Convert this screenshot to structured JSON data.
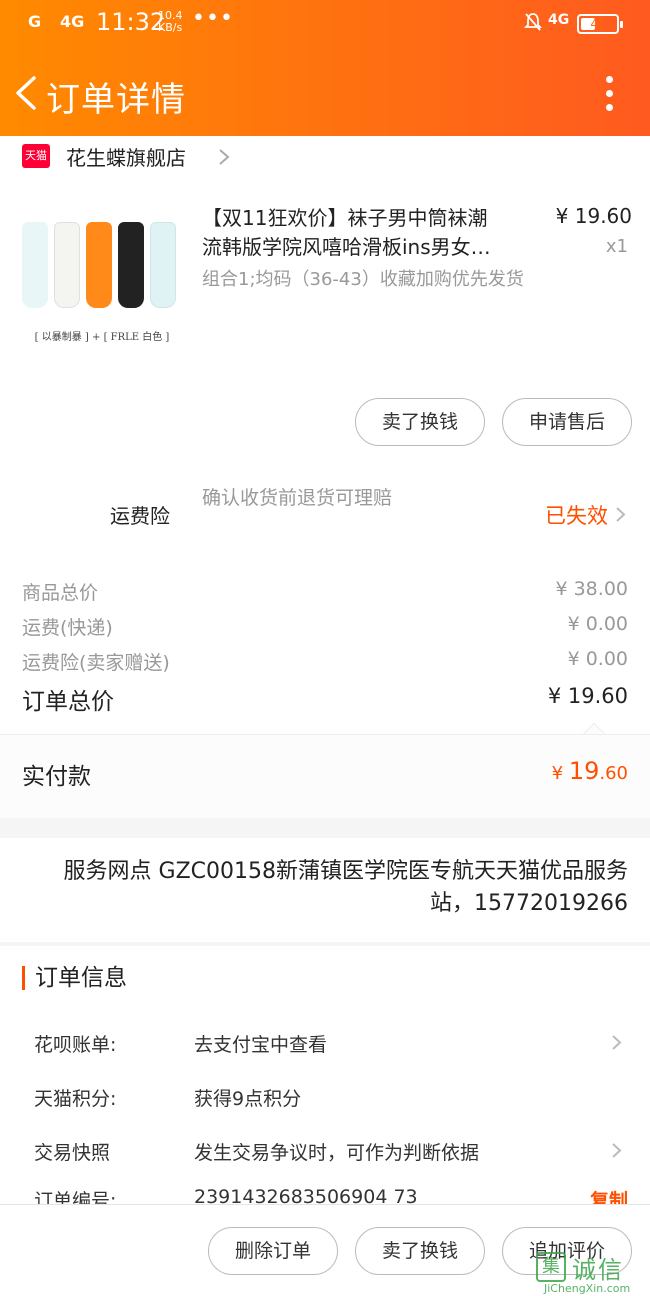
{
  "status_bar": {
    "signal_1": "G",
    "signal_2": "4G",
    "time": "11:32",
    "speed_value": "10.4",
    "speed_unit": "KB/s",
    "dots": "•••",
    "network": "4G",
    "battery": "41"
  },
  "nav": {
    "title": "订单详情"
  },
  "store": {
    "badge": "天猫",
    "name": "花生蝶旗舰店"
  },
  "product": {
    "title_line1": "【双11狂欢价】袜子男中筒袜潮",
    "title_line2": "流韩版学院风嘻哈滑板ins男女…",
    "price": "¥ 19.60",
    "qty": "x1",
    "spec": "组合1;均码（36-43）收藏加购优先发货",
    "image_caption": "[ 以暴制暴 ] + [ FRLE 白色 ]",
    "sock_colors": [
      "#e8f6f7",
      "#f4f4f0",
      "#ff8a1a",
      "#222222",
      "#dff3f5"
    ]
  },
  "order_actions": {
    "sell": "卖了换钱",
    "after_sale": "申请售后"
  },
  "insurance": {
    "label": "运费险",
    "desc": "确认收货前退货可理赔",
    "status": "已失效"
  },
  "prices": {
    "rows": [
      {
        "label": "商品总价",
        "value": "¥ 38.00"
      },
      {
        "label": "运费(快递)",
        "value": "¥ 0.00"
      },
      {
        "label": "运费险(卖家赠送)",
        "value": "¥ 0.00"
      }
    ],
    "total_label": "订单总价",
    "total_value": "¥ 19.60",
    "paid_label": "实付款",
    "paid_currency": "¥ ",
    "paid_int": "19",
    "paid_dec": ".60"
  },
  "service": {
    "title": "服务网点",
    "text": "GZC00158新蒲镇医学院医专航天天猫优品服务站，15772019266"
  },
  "order_info": {
    "heading": "订单信息",
    "rows": [
      {
        "key": "花呗账单:",
        "value": "去支付宝中查看"
      },
      {
        "key": "天猫积分:",
        "value": "获得9点积分"
      },
      {
        "key": "交易快照",
        "value": "发生交易争议时，可作为判断依据"
      },
      {
        "key": "订单编号:",
        "value": "2391432683506904 73",
        "action": "复制"
      }
    ]
  },
  "bottom_bar": {
    "delete": "删除订单",
    "sell": "卖了换钱",
    "review": "追加评价"
  },
  "watermark": {
    "cn": "诚信",
    "en": "JiChengXin.com",
    "logo": "集"
  },
  "colors": {
    "accent": "#ff5000",
    "header_start": "#ff8a00",
    "header_end": "#ff5a1f",
    "tmall": "#ff0036"
  }
}
